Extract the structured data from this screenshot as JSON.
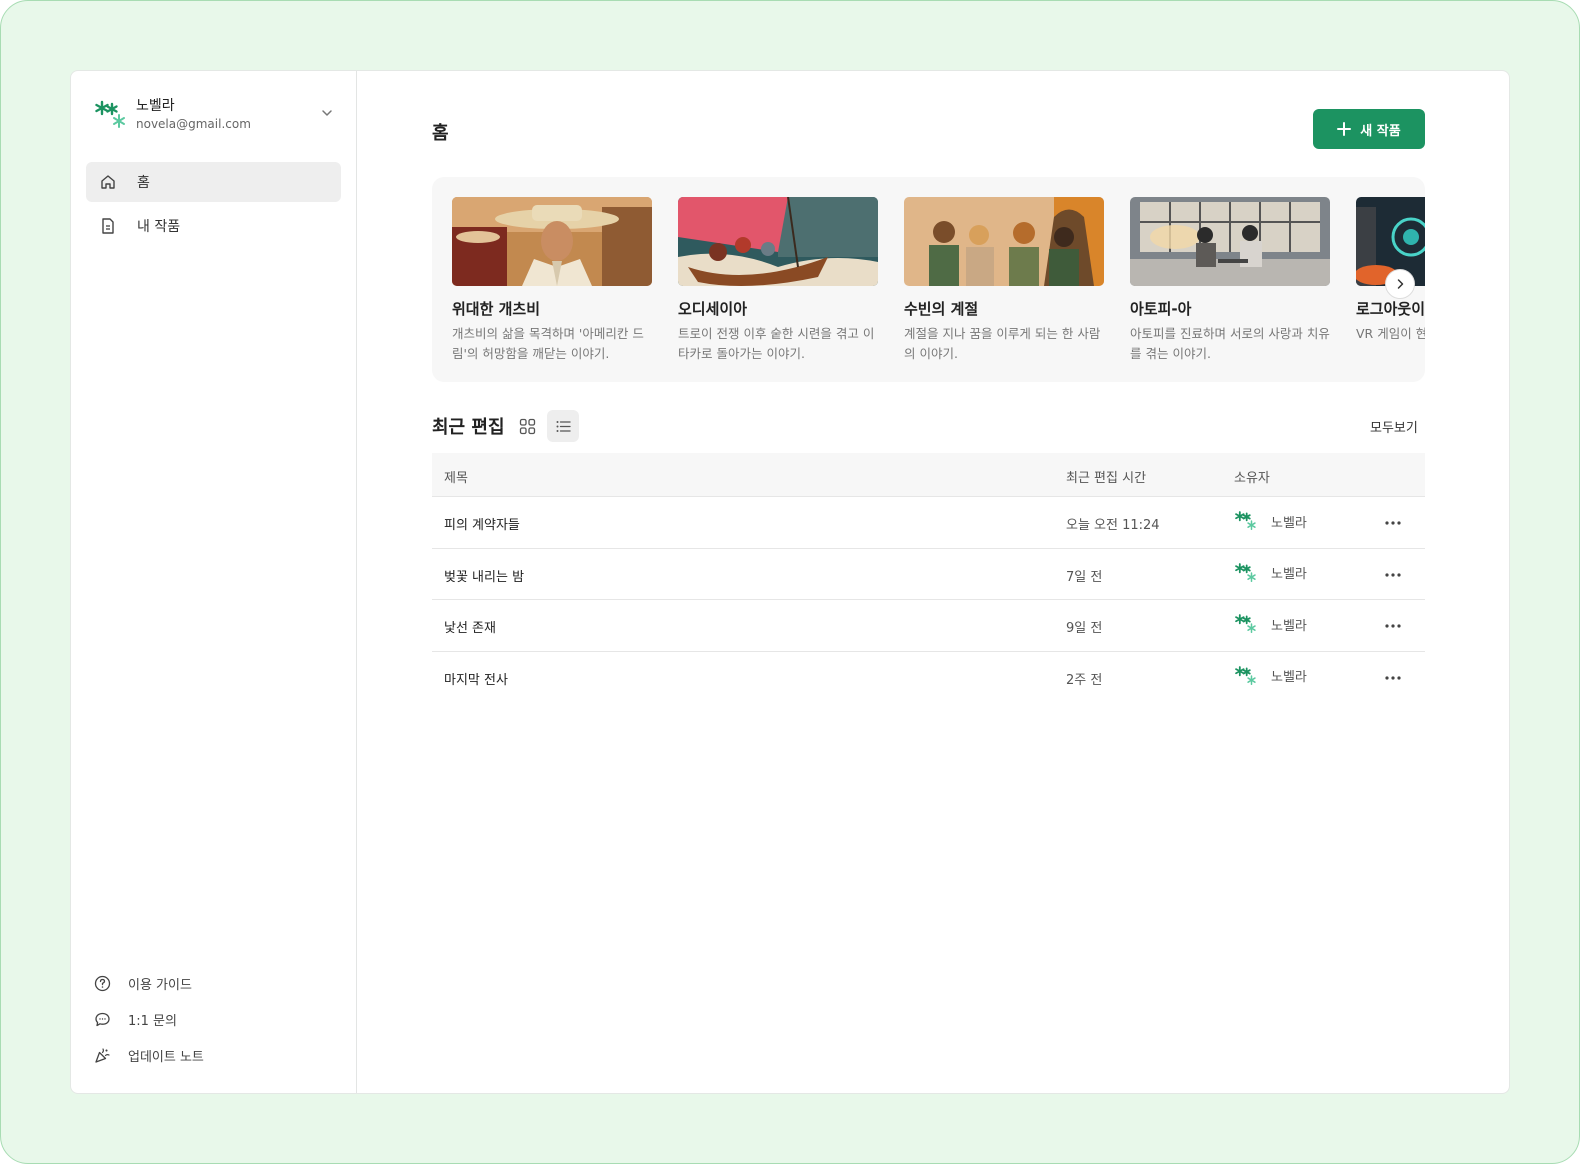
{
  "account": {
    "name": "노벨라",
    "email": "novela@gmail.com"
  },
  "nav": {
    "items": [
      {
        "label": "홈",
        "icon": "home-icon",
        "active": true
      },
      {
        "label": "내 작품",
        "icon": "document-icon",
        "active": false
      }
    ]
  },
  "footer": {
    "items": [
      {
        "label": "이용 가이드",
        "icon": "help-circle-icon"
      },
      {
        "label": "1:1 문의",
        "icon": "chat-bubble-icon"
      },
      {
        "label": "업데이트 노트",
        "icon": "party-popper-icon"
      }
    ]
  },
  "main": {
    "title": "홈",
    "new_button": "새 작품",
    "featured": [
      {
        "title": "위대한 개츠비",
        "desc": "개츠비의 삶을 목격하며 '아메리칸 드림'의 허망함을 깨닫는 이야기."
      },
      {
        "title": "오디세이아",
        "desc": "트로이 전쟁 이후 숱한 시련을 겪고 이타카로 돌아가는 이야기."
      },
      {
        "title": "수빈의 계절",
        "desc": "계절을 지나 꿈을 이루게 되는 한 사람의 이야기."
      },
      {
        "title": "아토피-아",
        "desc": "아토피를 진료하며 서로의 사랑과 치유를 겪는 이야기."
      },
      {
        "title": "로그아웃이",
        "desc": "VR 게임이 현 진실을 위해 /"
      }
    ],
    "recent": {
      "title": "최근 편집",
      "see_all": "모두보기",
      "columns": [
        "제목",
        "최근 편집 시간",
        "소유자"
      ],
      "rows": [
        {
          "title": "피의 계약자들",
          "time": "오늘 오전 11:24",
          "owner": "노벨라"
        },
        {
          "title": "벚꽃 내리는 밤",
          "time": "7일 전",
          "owner": "노벨라"
        },
        {
          "title": "낯선 존재",
          "time": "9일 전",
          "owner": "노벨라"
        },
        {
          "title": "마지막 전사",
          "time": "2주 전",
          "owner": "노벨라"
        }
      ]
    }
  },
  "colors": {
    "accent": "#1c9361",
    "outer_bg": "#e8f8ea",
    "logo_light": "#5cc9a0"
  }
}
